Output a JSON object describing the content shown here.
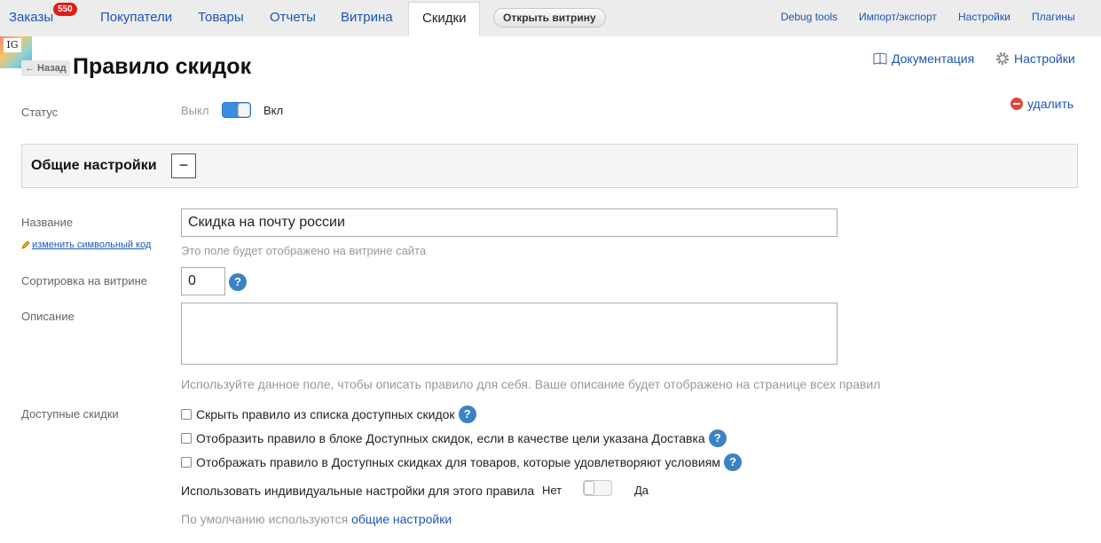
{
  "topnav": {
    "orders": "Заказы",
    "orders_badge": "550",
    "customers": "Покупатели",
    "products": "Товары",
    "reports": "Отчеты",
    "storefront": "Витрина",
    "discounts": "Скидки",
    "open_storefront": "Открыть витрину",
    "debug": "Debug tools",
    "import_export": "Импорт/экспорт",
    "settings": "Настройки",
    "plugins": "Плагины"
  },
  "header": {
    "logo": "IG",
    "back": "← Назад",
    "title": "Правило скидок",
    "docs": "Документация",
    "settings": "Настройки",
    "delete": "удалить"
  },
  "status": {
    "label": "Статус",
    "off": "Выкл",
    "on": "Вкл",
    "value": true
  },
  "general": {
    "title": "Общие настройки",
    "collapse": "−"
  },
  "form": {
    "name_label": "Название",
    "edit_code": "изменить символьный код",
    "name_value": "Скидка на почту россии",
    "name_hint": "Это поле будет отображено на витрине сайта",
    "sort_label": "Сортировка на витрине",
    "sort_value": "0",
    "help": "?",
    "desc_label": "Описание",
    "desc_value": "",
    "desc_hint": "Используйте данное поле, чтобы описать правило для себя. Ваше описание будет отображено на странице всех правил",
    "avail_label": "Доступные скидки",
    "checkboxes": [
      "Скрыть правило из списка доступных скидок",
      "Отобразить правило в блоке Доступных скидок, если в качестве цели указана Доставка",
      "Отображать правило в Доступных скидках для товаров, которые удовлетворяют условиям"
    ],
    "individual_label": "Использовать индивидуальные настройки для этого правила",
    "no": "Нет",
    "yes": "Да",
    "individual_value": false,
    "default_prefix": "По умолчанию используются",
    "default_link": "общие настройки"
  },
  "colors": {
    "link": "#1a56b8",
    "toggle_on": "#3a8de0",
    "badge": "#e21b1b",
    "help": "#3b82c4"
  }
}
